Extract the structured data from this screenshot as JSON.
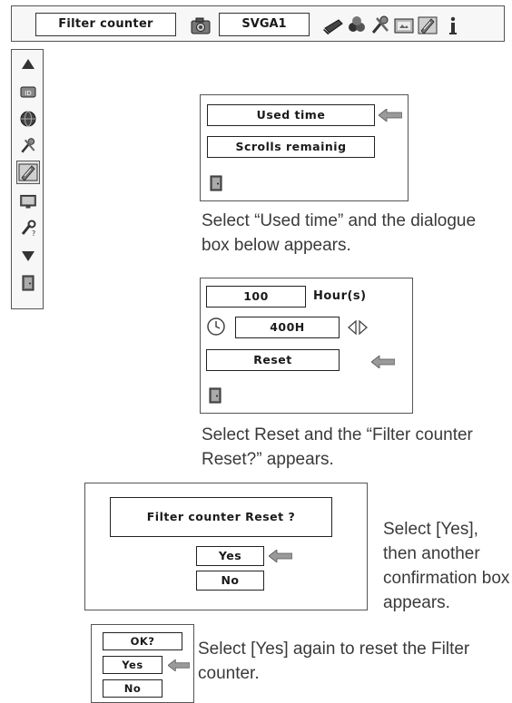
{
  "menubar": {
    "title": "Filter counter",
    "source": "SVGA1",
    "icons": [
      "camera-icon",
      "laptop-icon",
      "palette-icon",
      "tools-icon",
      "monitor-icon",
      "pencil-icon",
      "info-icon"
    ]
  },
  "sidebar": {
    "icons": [
      "up-arrow-icon",
      "id-tag-icon",
      "globe-icon",
      "tools-icon",
      "pencil-icon",
      "monitor-icon",
      "wrench-icon",
      "down-arrow-icon",
      "exit-icon"
    ],
    "selected": "pencil-icon"
  },
  "menu1": {
    "used_time": "Used time",
    "scrolls_remaining": "Scrolls remainig",
    "icons": [
      "pointer-arrow-icon",
      "exit-icon"
    ]
  },
  "caption1": "Select “Used time” and the dialogue box below appears.",
  "menu2": {
    "hours_value": "100",
    "hours_label": "Hour(s)",
    "timer_value": "400H",
    "reset_label": "Reset",
    "icons": [
      "clock-icon",
      "left-right-arrows-icon",
      "pointer-arrow-icon",
      "exit-icon"
    ]
  },
  "caption2": "Select Reset and the “Filter counter Reset?” appears.",
  "confirm1": {
    "message": "Filter counter Reset  ?",
    "yes": "Yes",
    "no": "No"
  },
  "caption3": "Select [Yes], then another confirmation box appears.",
  "confirm2": {
    "ok_label": "OK?",
    "yes": "Yes",
    "no": "No"
  },
  "caption4": "Select [Yes] again to reset the Filter counter.",
  "colors": {
    "border": "#555555",
    "arrow": "#8a8a8a",
    "text": "#1a1a1a",
    "caption": "#3a3a3a"
  }
}
